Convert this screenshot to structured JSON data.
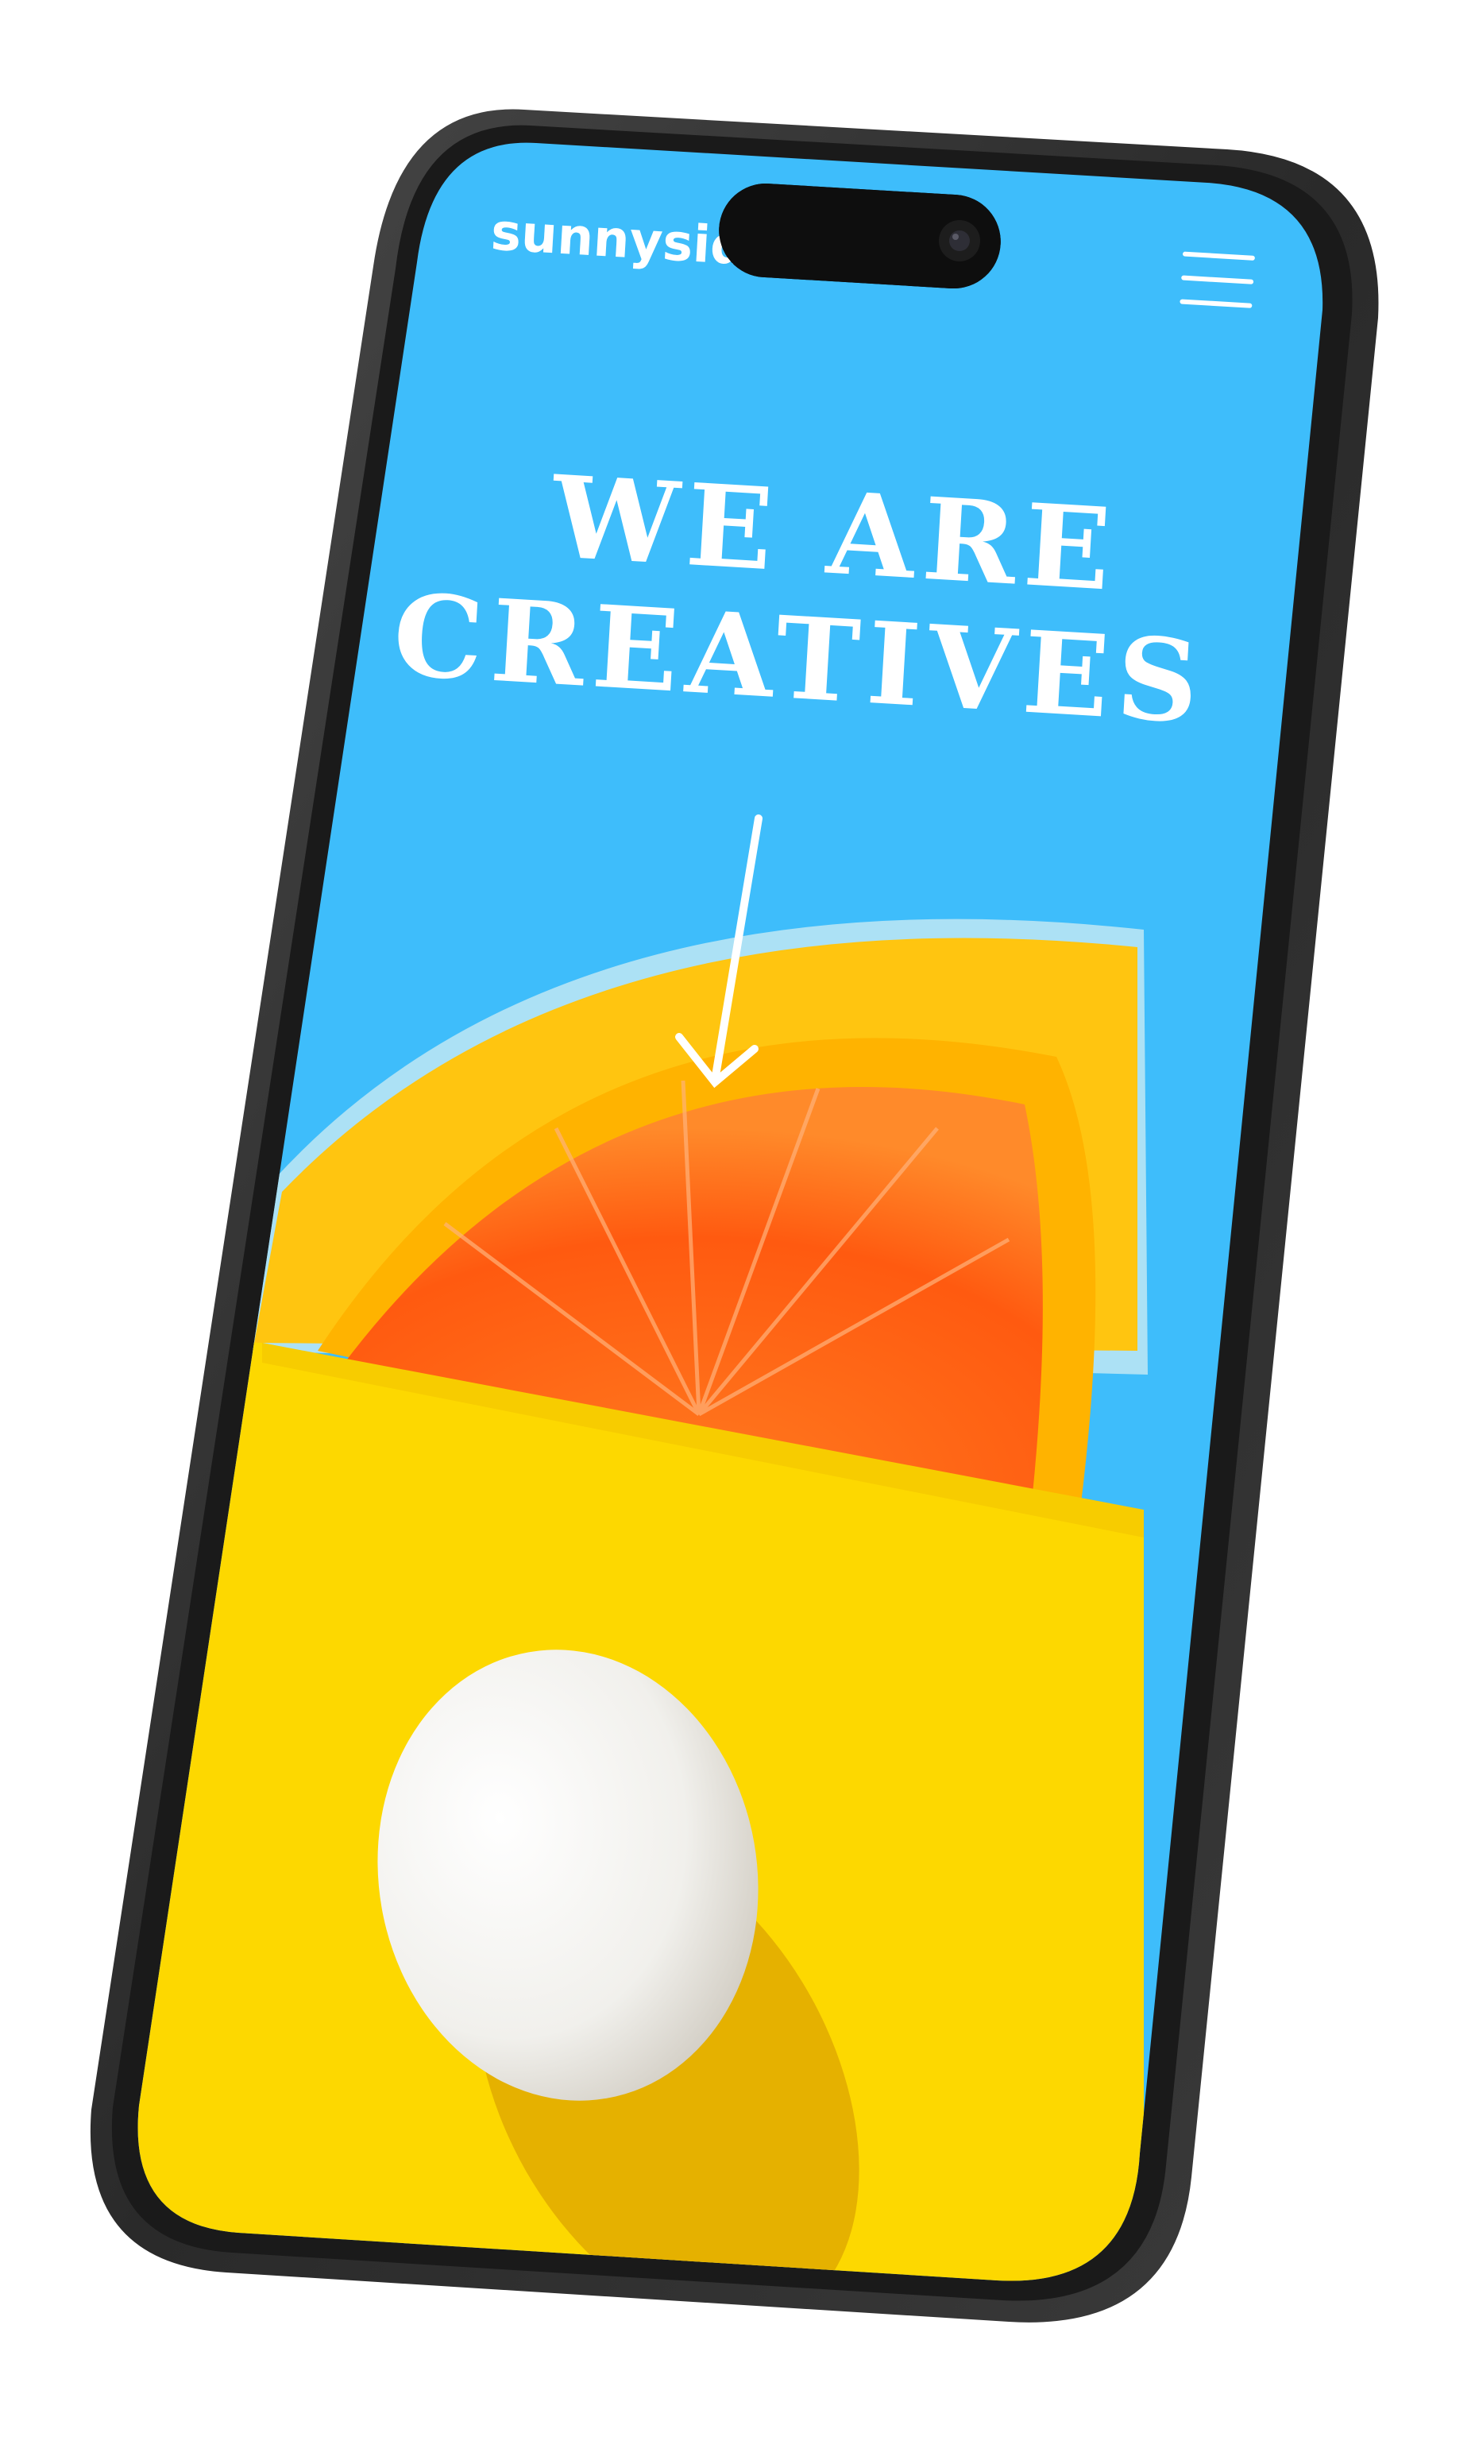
{
  "header": {
    "logo": "sunnyside",
    "menu_icon": "hamburger-menu-icon"
  },
  "hero": {
    "headline_line1": "WE ARE",
    "headline_line2": "CREATIVES",
    "scroll_icon": "arrow-down-icon"
  },
  "colors": {
    "sky": "#3EBDFB",
    "yellow": "#FDD800",
    "orange": "#FF6A1A",
    "phone_frame": "#2C2C2C"
  }
}
